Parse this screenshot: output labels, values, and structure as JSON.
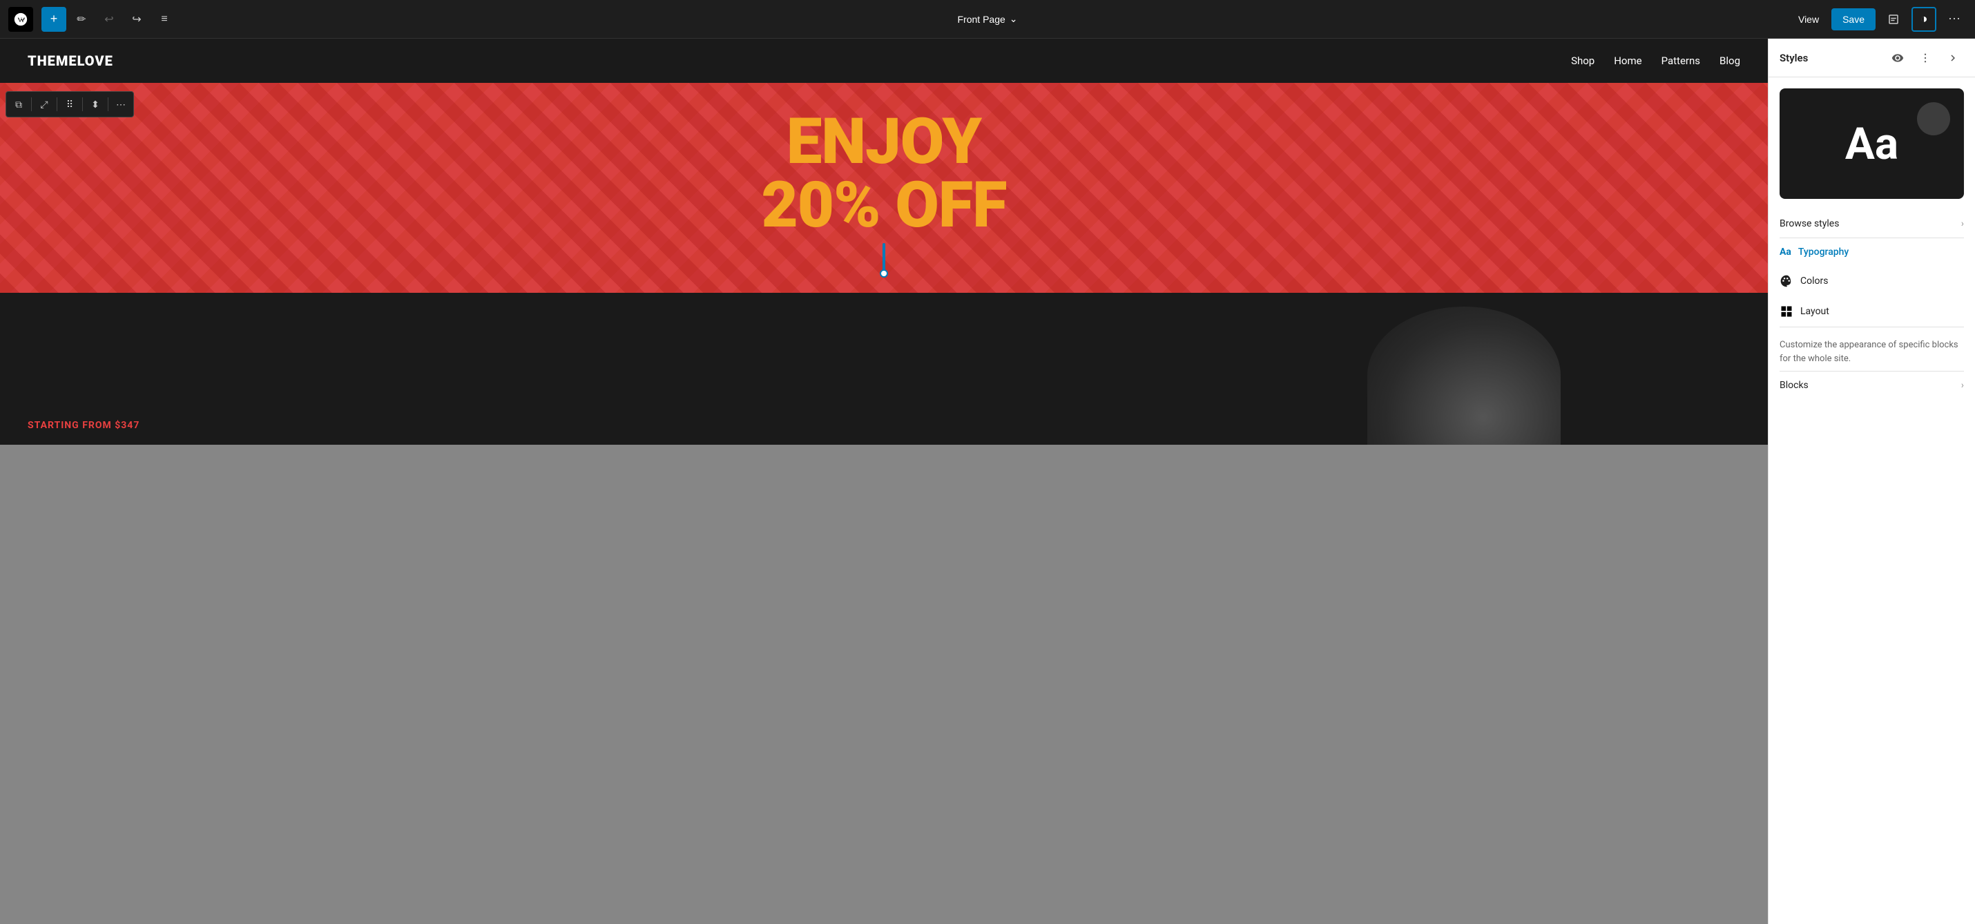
{
  "toolbar": {
    "wp_logo": "W",
    "add_label": "+",
    "pen_label": "✏",
    "undo_label": "↩",
    "redo_label": "↪",
    "list_view_label": "≡",
    "page_title": "Front Page",
    "chevron_down": "⌄",
    "view_label": "View",
    "save_label": "Save",
    "toggle_label": "◑",
    "more_label": "⋯"
  },
  "site": {
    "logo": "THEMELOVE",
    "nav": [
      "Shop",
      "Home",
      "Patterns",
      "Blog"
    ]
  },
  "hero": {
    "line1": "ENJOY",
    "line2": "20% OFF"
  },
  "block_toolbar": {
    "duplicate": "⧉",
    "expand": "⤢",
    "drag": "⠿",
    "arrows": "⬍",
    "more": "⋯"
  },
  "bottom": {
    "starting_text": "STARTING FROM $347"
  },
  "styles_panel": {
    "title": "Styles",
    "preview_text": "Aa",
    "eye_icon": "👁",
    "more_icon": "⋯",
    "expand_icon": "›",
    "browse_styles_label": "Browse styles",
    "typography_label": "Typography",
    "colors_label": "Colors",
    "layout_label": "Layout",
    "description": "Customize the appearance of specific blocks for the whole site.",
    "blocks_label": "Blocks",
    "typography_icon": "Aa",
    "colors_icon": "◎",
    "layout_icon": "▦"
  }
}
